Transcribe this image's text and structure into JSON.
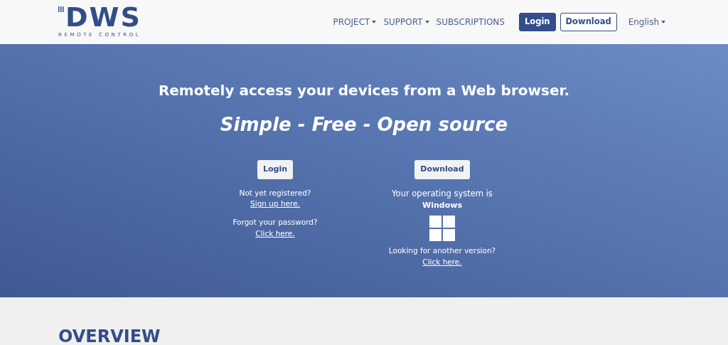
{
  "logo": {
    "mark": "DWS",
    "subtitle": "REMOTE CONTROL"
  },
  "nav": {
    "items": [
      {
        "label": "PROJECT",
        "dropdown": true
      },
      {
        "label": "SUPPORT",
        "dropdown": true
      },
      {
        "label": "SUBSCRIPTIONS",
        "dropdown": false
      }
    ],
    "buttons": [
      {
        "label": "Login",
        "kind": "primary"
      },
      {
        "label": "Download",
        "kind": "outline"
      }
    ],
    "language": {
      "label": "English",
      "dropdown": true
    }
  },
  "hero": {
    "headline": "Remotely access your devices from a Web browser.",
    "tagline": "Simple - Free - Open source",
    "login": {
      "button": "Login",
      "register_text": "Not yet registered?",
      "register_link": "Sign up here.",
      "forgot_text": "Forgot your password?",
      "forgot_link": "Click here."
    },
    "download": {
      "button": "Download",
      "os_text": "Your operating system is",
      "os_name": "Windows",
      "other_text": "Looking for another version?",
      "other_link": "Click here."
    }
  },
  "section": {
    "title": "OVERVIEW"
  }
}
